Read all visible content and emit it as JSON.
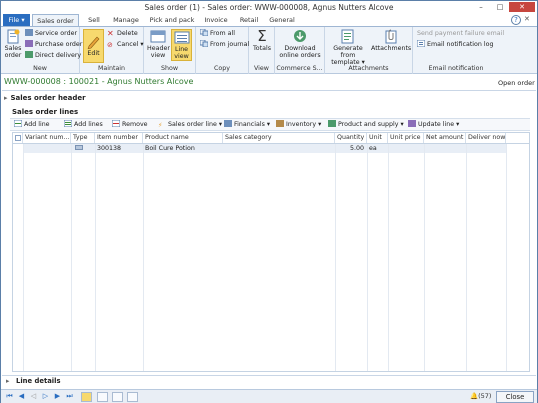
{
  "window": {
    "title": "Sales order (1) - Sales order: WWW-000008, Agnus Nutters Alcove",
    "minimize": "–",
    "maximize": "□",
    "close": "✕"
  },
  "tabs": [
    "Sales order",
    "Sell",
    "Manage",
    "Pick and pack",
    "Invoice",
    "Retail",
    "General"
  ],
  "file_tab": "File ▾",
  "help": "?",
  "ribbon_close": "✕",
  "ribbon": {
    "new": {
      "label": "New",
      "sales_order": "Sales order",
      "service_order": "Service order",
      "purchase_order": "Purchase order",
      "direct_delivery": "Direct delivery"
    },
    "maintain": {
      "label": "Maintain",
      "edit": "Edit",
      "delete": "Delete",
      "cancel": "Cancel ▾"
    },
    "show": {
      "label": "Show",
      "header_view": "Header view",
      "line_view": "Line view"
    },
    "copy": {
      "label": "Copy",
      "from_all": "From all",
      "from_journal": "From journal"
    },
    "view": {
      "label": "View",
      "totals": "Totals"
    },
    "commerce": {
      "label": "Commerce S...",
      "download": "Download online orders"
    },
    "attachments": {
      "label": "Attachments",
      "generate": "Generate from template ▾",
      "attachments": "Attachments"
    },
    "email": {
      "label": "Email notification",
      "send_failure": "Send payment failure email",
      "log": "Email notification log"
    }
  },
  "breadcrumb": "WWW-000008 : 100021 - Agnus Nutters Alcove",
  "open_order": "Open order",
  "sales_order_header": "Sales order header",
  "sales_order_lines": "Sales order lines",
  "line_toolbar": [
    "Add line",
    "Add lines",
    "Remove",
    "Sales order line ▾",
    "Financials ▾",
    "Inventory ▾",
    "Product and supply ▾",
    "Update line ▾"
  ],
  "grid": {
    "columns": [
      "Variant num...",
      "Type",
      "Item number",
      "Product name",
      "Sales category",
      "Quantity",
      "Unit",
      "Unit price",
      "Net amount",
      "Deliver now"
    ],
    "rows": [
      {
        "item_number": "300138",
        "product_name": "Boil Cure Potion",
        "quantity": "5.00",
        "unit": "ea"
      }
    ]
  },
  "line_details": "Line details",
  "status": {
    "notifications": "(57)",
    "close": "Close"
  }
}
